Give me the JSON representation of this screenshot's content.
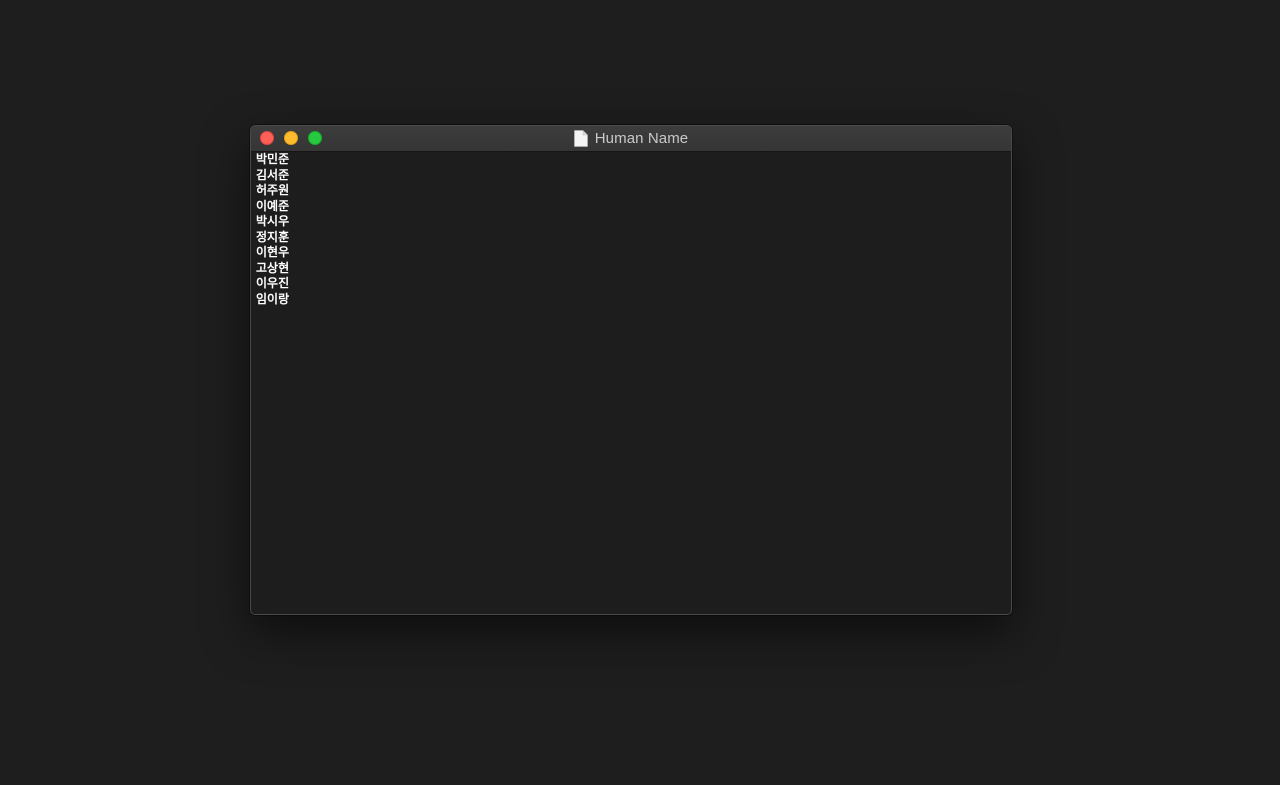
{
  "window": {
    "title": "Human Name",
    "icon": "document-icon",
    "buttons": {
      "close": "close",
      "minimize": "minimize",
      "zoom": "zoom"
    },
    "colors": {
      "close": "#fe5f57",
      "minimize": "#febc2e",
      "zoom": "#28c840"
    }
  },
  "names": [
    "박민준",
    "김서준",
    "허주원",
    "이예준",
    "박시우",
    "정지훈",
    "이현우",
    "고상현",
    "이우진",
    "임이랑"
  ]
}
